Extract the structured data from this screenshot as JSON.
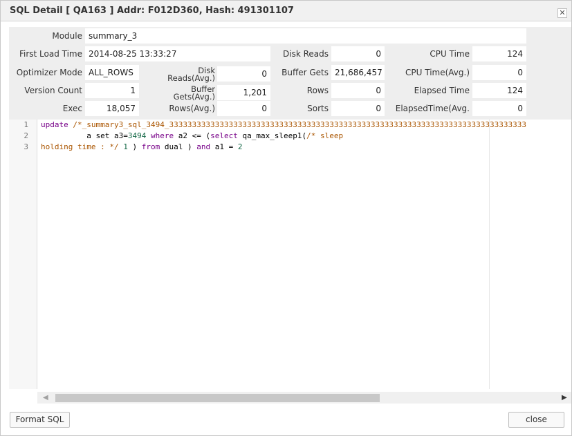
{
  "window": {
    "title": "SQL Detail [ QA163 ] Addr: F012D360, Hash: 491301107",
    "close_glyph": "✕"
  },
  "fields": {
    "module": {
      "label": "Module",
      "value": "summary_3"
    },
    "first_load_time": {
      "label": "First Load Time",
      "value": "2014-08-25 13:33:27"
    },
    "optimizer_mode": {
      "label": "Optimizer Mode",
      "value": "ALL_ROWS"
    },
    "version_count": {
      "label": "Version Count",
      "value": "1"
    },
    "exec": {
      "label": "Exec",
      "value": "18,057"
    },
    "disk_reads_avg": {
      "label_line1": "Disk",
      "label_line2": "Reads(Avg.)",
      "value": "0"
    },
    "buffer_gets_avg": {
      "label_line1": "Buffer",
      "label_line2": "Gets(Avg.)",
      "value": "1,201"
    },
    "rows_avg": {
      "label": "Rows(Avg.)",
      "value": "0"
    },
    "disk_reads": {
      "label": "Disk Reads",
      "value": "0"
    },
    "buffer_gets": {
      "label": "Buffer Gets",
      "value": "21,686,457"
    },
    "rows": {
      "label": "Rows",
      "value": "0"
    },
    "sorts": {
      "label": "Sorts",
      "value": "0"
    },
    "cpu_time": {
      "label": "CPU Time",
      "value": "124"
    },
    "cpu_time_avg": {
      "label": "CPU Time(Avg.)",
      "value": "0"
    },
    "elapsed_time": {
      "label": "Elapsed Time",
      "value": "124"
    },
    "elapsed_time_avg": {
      "label": "ElapsedTime(Avg.",
      "value": "0"
    }
  },
  "editor": {
    "line_numbers": [
      "1",
      "2",
      "3"
    ],
    "line1": {
      "kw": "update",
      "comment": " /*_summary3_sql_3494_333333333333333333333333333333333333333333333333333333333333333333333333333333"
    },
    "line2": {
      "indent": "          a set a3=",
      "num1": "3494",
      "kw1": " where",
      "mid": " a2 <= (",
      "kw2": "select",
      "tail": " qa_max_sleep1(",
      "comment": "/* sleep"
    },
    "line3": {
      "comment": "holding time : */",
      "sp": " ",
      "num1": "1",
      "mid": " ) ",
      "kw1": "from",
      "mid2": " dual ) ",
      "kw2": "and",
      "mid3": " a1 = ",
      "num2": "2"
    },
    "scroll_left_glyph": "◀",
    "scroll_right_glyph": "▶"
  },
  "buttons": {
    "format_sql": "Format SQL",
    "close": "close"
  }
}
